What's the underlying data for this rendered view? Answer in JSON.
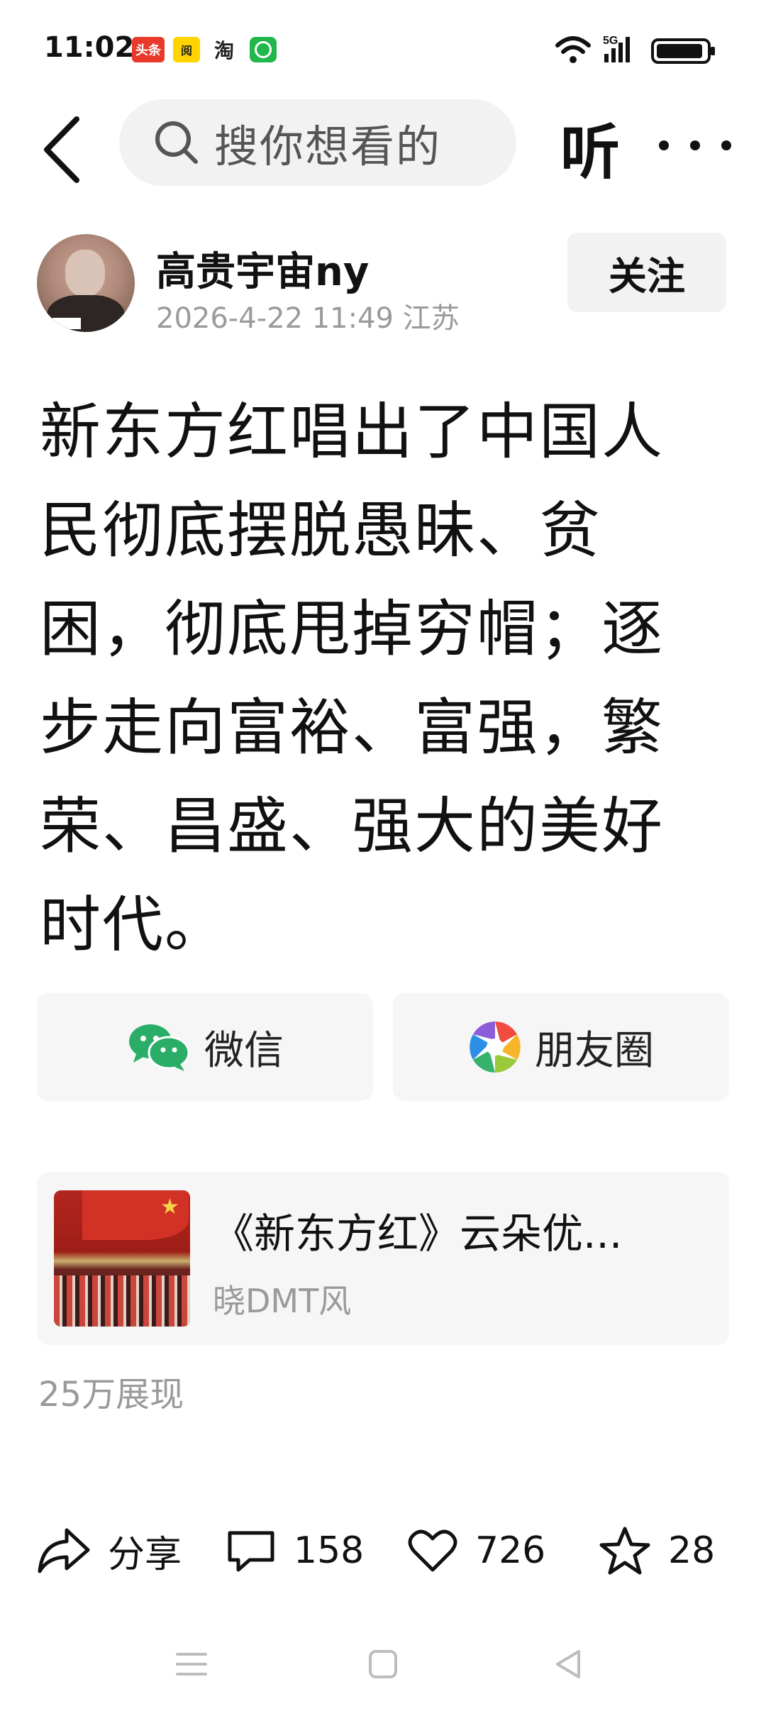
{
  "status_bar": {
    "time": "11:02",
    "app_icons": [
      "头条",
      "阅",
      "淘"
    ],
    "network": "5G"
  },
  "top_nav": {
    "search_placeholder": "搜你想看的",
    "listen_label": "听"
  },
  "author": {
    "name": "高贵宇宙ny",
    "date": "2026-4-22 11:49",
    "location": "江苏",
    "follow_label": "关注"
  },
  "article": {
    "lines": [
      "新东方红唱出了中国人",
      "民彻底摆脱愚昧、贫",
      "困，彻底甩掉穷帽；逐",
      "步走向富裕、富强，繁",
      "荣、昌盛、强大的美好",
      "时代。"
    ]
  },
  "share": {
    "wechat_label": "微信",
    "moments_label": "朋友圈"
  },
  "related": {
    "title": "《新东方红》云朵优...",
    "source": "晓DMT风"
  },
  "impressions": "25万展现",
  "actions": {
    "share_label": "分享",
    "comment_count": "158",
    "like_count": "726",
    "favorite_count": "28"
  },
  "colors": {
    "wechat_green": "#2aae67",
    "placeholder_gray": "#555555",
    "meta_gray": "#9a9a9a",
    "card_bg": "#f6f6f6"
  }
}
